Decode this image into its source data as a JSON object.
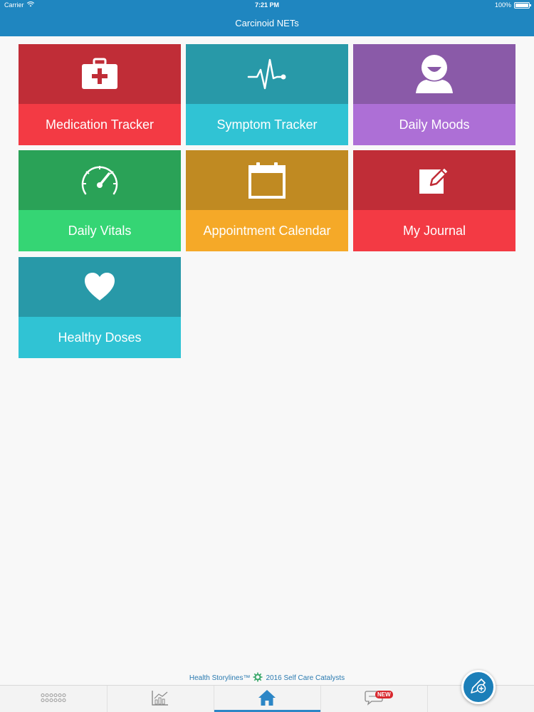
{
  "status_bar": {
    "carrier": "Carrier",
    "time": "7:21 PM",
    "battery": "100%"
  },
  "nav": {
    "title": "Carcinoid NETs"
  },
  "tiles": [
    {
      "label": "Medication Tracker",
      "icon": "first-aid-kit-icon",
      "top_color": "#c02d37",
      "bottom_color": "#f33a44"
    },
    {
      "label": "Symptom Tracker",
      "icon": "heartbeat-icon",
      "top_color": "#2899a8",
      "bottom_color": "#30c3d4"
    },
    {
      "label": "Daily Moods",
      "icon": "smiley-face-icon",
      "top_color": "#8a5aa8",
      "bottom_color": "#ad6fd6"
    },
    {
      "label": "Daily Vitals",
      "icon": "speedometer-icon",
      "top_color": "#2aa257",
      "bottom_color": "#35d574"
    },
    {
      "label": "Appointment Calendar",
      "icon": "calendar-icon",
      "top_color": "#c08a22",
      "bottom_color": "#f5a928"
    },
    {
      "label": "My Journal",
      "icon": "edit-note-icon",
      "top_color": "#c02d37",
      "bottom_color": "#f33a44"
    },
    {
      "label": "Healthy Doses",
      "icon": "heart-icon",
      "top_color": "#2899a8",
      "bottom_color": "#30c3d4"
    }
  ],
  "footer": {
    "brand": "Health Storylines™",
    "copyright": "2016 Self Care Catalysts"
  },
  "tab_bar": {
    "tabs": [
      {
        "icon": "dots-grid-icon"
      },
      {
        "icon": "chart-icon"
      },
      {
        "icon": "home-icon",
        "active": true
      },
      {
        "icon": "chat-icon",
        "badge": "NEW"
      }
    ],
    "fab_icon": "add-entry-icon"
  }
}
